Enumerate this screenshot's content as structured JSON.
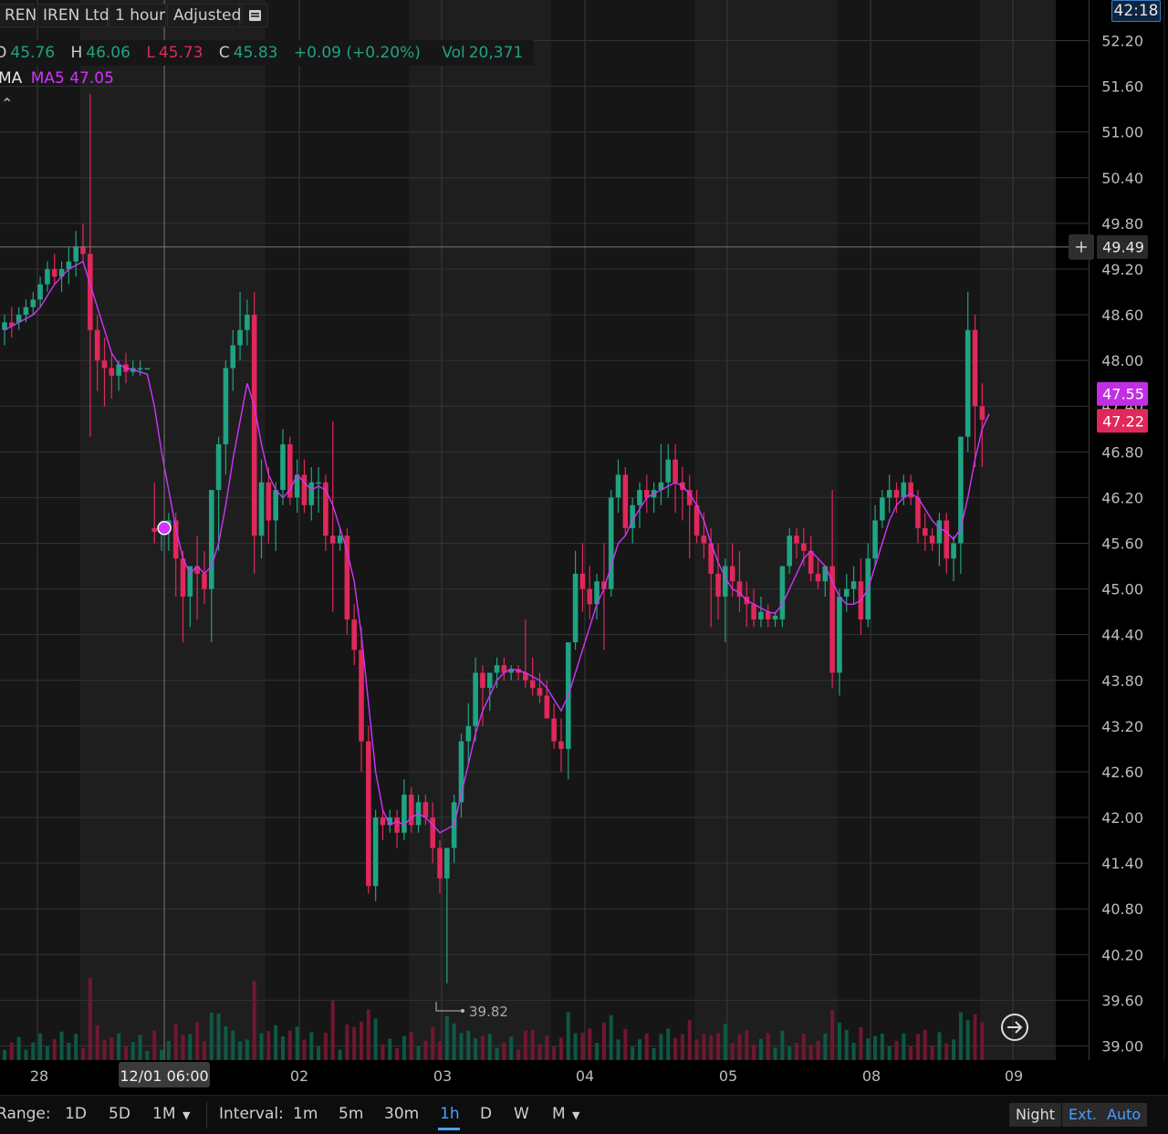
{
  "header": {
    "symbol": "REN",
    "company": "IREN Ltd",
    "interval": "1 hour",
    "adjustment": "Adjusted",
    "menu_icon": "list-icon"
  },
  "ohlc": {
    "open_label": "O",
    "open": "45.76",
    "high_label": "H",
    "high": "46.06",
    "low_label": "L",
    "low": "45.73",
    "close_label": "C",
    "close": "45.83",
    "change": "+0.09 (+0.20%)",
    "vol_label": "Vol",
    "vol": "20,371"
  },
  "indicator": {
    "name": "MA",
    "value_text": "MA5 47.05"
  },
  "clock": "42:18",
  "colors": {
    "up": "#1fa383",
    "down": "#e0285a",
    "ma": "#d233ff",
    "accent": "#4a9eff"
  },
  "chart_data": {
    "type": "candlestick",
    "y_ticks": [
      "52.20",
      "51.60",
      "51.00",
      "50.40",
      "49.80",
      "49.20",
      "48.60",
      "48.00",
      "47.40",
      "46.80",
      "46.20",
      "45.60",
      "45.00",
      "44.40",
      "43.80",
      "43.20",
      "42.60",
      "42.00",
      "41.40",
      "40.80",
      "40.20",
      "39.60",
      "39.00"
    ],
    "ylim": [
      38.9,
      52.4
    ],
    "x_ticks": [
      {
        "label": "28",
        "i": 3
      },
      {
        "label": "02",
        "i": 46
      },
      {
        "label": "03",
        "i": 66
      },
      {
        "label": "04",
        "i": 86
      },
      {
        "label": "05",
        "i": 106
      },
      {
        "label": "08",
        "i": 126
      },
      {
        "label": "09",
        "i": 146
      }
    ],
    "crosshair": {
      "date_label": "12/01 06:00",
      "price_label": "49.49",
      "price": 49.49,
      "i": 22
    },
    "last_close": "47.22",
    "ma_last": "47.55",
    "low_marker": "39.82",
    "candles": [
      [
        48.4,
        48.6,
        48.2,
        48.5
      ],
      [
        48.5,
        48.7,
        48.3,
        48.45
      ],
      [
        48.5,
        48.7,
        48.4,
        48.6
      ],
      [
        48.6,
        48.8,
        48.5,
        48.7
      ],
      [
        48.7,
        48.9,
        48.6,
        48.8
      ],
      [
        48.8,
        49.1,
        48.7,
        49.0
      ],
      [
        49.0,
        49.3,
        48.9,
        49.2
      ],
      [
        49.2,
        49.4,
        49.0,
        49.1
      ],
      [
        49.1,
        49.3,
        48.9,
        49.2
      ],
      [
        49.2,
        49.5,
        49.0,
        49.3
      ],
      [
        49.3,
        49.7,
        49.1,
        49.5
      ],
      [
        49.5,
        49.8,
        49.3,
        49.4
      ],
      [
        49.4,
        51.5,
        47.0,
        48.4
      ],
      [
        48.4,
        48.6,
        47.6,
        48.0
      ],
      [
        48.0,
        48.3,
        47.4,
        47.9
      ],
      [
        47.9,
        48.1,
        47.5,
        47.8
      ],
      [
        47.8,
        48.0,
        47.6,
        47.95
      ],
      [
        47.95,
        48.1,
        47.7,
        47.85
      ],
      [
        47.85,
        48.0,
        47.8,
        47.9
      ],
      [
        47.9,
        48.0,
        47.8,
        47.9
      ],
      [
        47.9,
        47.9,
        47.9,
        47.9
      ],
      [
        45.8,
        46.4,
        45.6,
        45.75
      ],
      [
        45.75,
        45.9,
        45.5,
        45.8
      ],
      [
        45.8,
        46.0,
        45.5,
        45.9
      ],
      [
        45.9,
        46.0,
        44.9,
        45.4
      ],
      [
        45.4,
        45.5,
        44.3,
        44.9
      ],
      [
        44.9,
        45.3,
        44.5,
        45.3
      ],
      [
        45.3,
        45.7,
        44.6,
        45.2
      ],
      [
        45.2,
        45.5,
        44.8,
        45.0
      ],
      [
        45.0,
        46.3,
        44.3,
        46.3
      ],
      [
        46.3,
        47.0,
        45.5,
        46.9
      ],
      [
        46.9,
        48.0,
        46.5,
        47.9
      ],
      [
        47.9,
        48.4,
        47.6,
        48.2
      ],
      [
        48.2,
        48.9,
        48.0,
        48.4
      ],
      [
        48.4,
        48.8,
        48.2,
        48.6
      ],
      [
        48.6,
        48.9,
        45.2,
        45.7
      ],
      [
        45.7,
        46.7,
        45.4,
        46.4
      ],
      [
        46.4,
        46.6,
        45.6,
        45.9
      ],
      [
        45.9,
        46.4,
        45.5,
        46.3
      ],
      [
        46.3,
        47.1,
        46.1,
        46.9
      ],
      [
        46.9,
        47.0,
        46.1,
        46.2
      ],
      [
        46.2,
        46.7,
        46.0,
        46.5
      ],
      [
        46.5,
        46.7,
        46.0,
        46.1
      ],
      [
        46.1,
        46.6,
        45.9,
        46.4
      ],
      [
        46.4,
        46.6,
        46.0,
        46.4
      ],
      [
        46.4,
        46.5,
        45.5,
        45.7
      ],
      [
        45.7,
        47.2,
        44.7,
        45.6
      ],
      [
        45.6,
        45.8,
        45.5,
        45.7
      ],
      [
        45.7,
        45.8,
        44.4,
        44.6
      ],
      [
        44.6,
        44.8,
        44.0,
        44.2
      ],
      [
        44.2,
        44.5,
        42.6,
        43.0
      ],
      [
        43.0,
        43.2,
        41.0,
        41.1
      ],
      [
        41.1,
        42.1,
        40.9,
        42.0
      ],
      [
        42.0,
        42.1,
        41.7,
        41.9
      ],
      [
        41.9,
        42.1,
        41.8,
        42.0
      ],
      [
        42.0,
        42.1,
        41.6,
        41.8
      ],
      [
        41.8,
        42.5,
        41.7,
        42.3
      ],
      [
        42.3,
        42.4,
        41.8,
        41.9
      ],
      [
        41.9,
        42.3,
        41.8,
        42.2
      ],
      [
        42.2,
        42.3,
        41.9,
        42.0
      ],
      [
        42.0,
        42.2,
        41.4,
        41.6
      ],
      [
        41.6,
        41.7,
        41.0,
        41.2
      ],
      [
        41.2,
        41.6,
        39.82,
        41.6
      ],
      [
        41.6,
        42.3,
        41.4,
        42.2
      ],
      [
        42.2,
        43.1,
        42.0,
        43.0
      ],
      [
        43.0,
        43.5,
        42.7,
        43.2
      ],
      [
        43.2,
        44.1,
        43.0,
        43.9
      ],
      [
        43.9,
        44.0,
        43.2,
        43.7
      ],
      [
        43.7,
        43.9,
        43.4,
        43.9
      ],
      [
        43.9,
        44.1,
        43.7,
        44.0
      ],
      [
        44.0,
        44.1,
        43.8,
        43.9
      ],
      [
        43.9,
        44.0,
        43.8,
        43.95
      ],
      [
        43.95,
        44.0,
        43.8,
        43.9
      ],
      [
        43.9,
        44.6,
        43.7,
        43.8
      ],
      [
        43.8,
        44.1,
        43.6,
        43.7
      ],
      [
        43.7,
        43.9,
        43.5,
        43.6
      ],
      [
        43.6,
        43.8,
        43.3,
        43.3
      ],
      [
        43.3,
        43.5,
        42.9,
        43.0
      ],
      [
        43.0,
        43.3,
        42.6,
        42.9
      ],
      [
        42.9,
        44.3,
        42.5,
        44.3
      ],
      [
        44.3,
        45.5,
        44.2,
        45.2
      ],
      [
        45.2,
        45.6,
        44.7,
        45.0
      ],
      [
        45.0,
        45.3,
        44.6,
        44.8
      ],
      [
        44.8,
        45.2,
        44.6,
        45.1
      ],
      [
        45.1,
        45.6,
        44.2,
        45.0
      ],
      [
        45.0,
        46.3,
        44.9,
        46.2
      ],
      [
        46.2,
        46.7,
        46.0,
        46.5
      ],
      [
        46.5,
        46.6,
        45.7,
        45.8
      ],
      [
        45.8,
        46.2,
        45.6,
        46.1
      ],
      [
        46.1,
        46.4,
        45.8,
        46.3
      ],
      [
        46.3,
        46.5,
        46.0,
        46.2
      ],
      [
        46.2,
        46.4,
        46.0,
        46.3
      ],
      [
        46.3,
        46.9,
        46.1,
        46.4
      ],
      [
        46.4,
        46.9,
        46.2,
        46.7
      ],
      [
        46.7,
        46.9,
        46.0,
        46.4
      ],
      [
        46.4,
        46.6,
        45.9,
        46.3
      ],
      [
        46.3,
        46.5,
        45.4,
        46.1
      ],
      [
        46.1,
        46.3,
        45.6,
        45.7
      ],
      [
        45.7,
        46.0,
        45.4,
        45.6
      ],
      [
        45.6,
        45.8,
        44.5,
        45.2
      ],
      [
        45.2,
        45.6,
        44.6,
        44.9
      ],
      [
        44.9,
        45.4,
        44.3,
        45.3
      ],
      [
        45.3,
        45.6,
        44.9,
        45.1
      ],
      [
        45.1,
        45.5,
        44.7,
        44.9
      ],
      [
        44.9,
        45.1,
        44.5,
        44.8
      ],
      [
        44.8,
        45.0,
        44.5,
        44.6
      ],
      [
        44.6,
        44.9,
        44.5,
        44.7
      ],
      [
        44.7,
        44.8,
        44.5,
        44.6
      ],
      [
        44.6,
        44.7,
        44.5,
        44.65
      ],
      [
        44.6,
        45.3,
        44.5,
        45.3
      ],
      [
        45.3,
        45.8,
        45.2,
        45.7
      ],
      [
        45.7,
        45.8,
        45.4,
        45.6
      ],
      [
        45.6,
        45.8,
        45.3,
        45.5
      ],
      [
        45.5,
        45.7,
        45.1,
        45.2
      ],
      [
        45.2,
        45.4,
        45.0,
        45.1
      ],
      [
        45.1,
        45.3,
        44.9,
        45.3
      ],
      [
        45.3,
        46.3,
        43.7,
        43.9
      ],
      [
        43.9,
        45.0,
        43.6,
        44.9
      ],
      [
        44.9,
        45.2,
        44.7,
        45.0
      ],
      [
        45.0,
        45.3,
        44.8,
        45.1
      ],
      [
        45.1,
        45.4,
        44.4,
        44.6
      ],
      [
        44.6,
        45.6,
        44.5,
        45.4
      ],
      [
        45.4,
        46.1,
        45.3,
        45.9
      ],
      [
        45.9,
        46.3,
        45.8,
        46.2
      ],
      [
        46.2,
        46.5,
        46.0,
        46.3
      ],
      [
        46.3,
        46.4,
        46.0,
        46.2
      ],
      [
        46.2,
        46.5,
        46.1,
        46.4
      ],
      [
        46.4,
        46.5,
        46.1,
        46.2
      ],
      [
        46.2,
        46.3,
        45.6,
        45.8
      ],
      [
        45.8,
        46.0,
        45.5,
        45.7
      ],
      [
        45.7,
        45.8,
        45.5,
        45.6
      ],
      [
        45.6,
        46.0,
        45.3,
        45.9
      ],
      [
        45.9,
        46.0,
        45.2,
        45.4
      ],
      [
        45.4,
        45.7,
        45.1,
        45.6
      ],
      [
        45.6,
        47.0,
        45.2,
        47.0
      ],
      [
        47.0,
        48.9,
        46.8,
        48.4
      ],
      [
        48.4,
        48.6,
        46.6,
        47.4
      ],
      [
        47.4,
        47.7,
        46.6,
        47.22
      ]
    ],
    "ma5": [
      48.4,
      48.45,
      48.5,
      48.55,
      48.6,
      48.7,
      48.85,
      49.0,
      49.1,
      49.2,
      49.25,
      49.3,
      49.0,
      48.7,
      48.4,
      48.1,
      47.95,
      47.9,
      47.88,
      47.85,
      47.82,
      47.4,
      46.8,
      46.3,
      45.8,
      45.4,
      45.2,
      45.3,
      45.2,
      45.3,
      45.6,
      46.1,
      46.7,
      47.2,
      47.7,
      47.4,
      46.9,
      46.5,
      46.3,
      46.2,
      46.3,
      46.5,
      46.4,
      46.3,
      46.35,
      46.3,
      46.1,
      45.8,
      45.5,
      45.1,
      44.4,
      43.5,
      42.6,
      42.1,
      41.9,
      41.95,
      41.9,
      42.0,
      42.05,
      42.0,
      41.9,
      41.8,
      41.85,
      41.9,
      42.3,
      42.7,
      43.1,
      43.4,
      43.6,
      43.8,
      43.9,
      43.95,
      43.93,
      43.9,
      43.85,
      43.8,
      43.7,
      43.55,
      43.4,
      43.6,
      43.9,
      44.2,
      44.5,
      44.8,
      45.0,
      45.3,
      45.6,
      45.7,
      45.9,
      46.05,
      46.2,
      46.25,
      46.3,
      46.35,
      46.4,
      46.35,
      46.25,
      46.1,
      45.9,
      45.6,
      45.35,
      45.15,
      45.0,
      44.95,
      44.85,
      44.8,
      44.75,
      44.7,
      44.68,
      44.8,
      45.0,
      45.2,
      45.4,
      45.5,
      45.4,
      45.3,
      45.1,
      44.9,
      44.8,
      44.8,
      44.85,
      45.0,
      45.3,
      45.6,
      45.9,
      46.1,
      46.2,
      46.25,
      46.2,
      46.05,
      45.9,
      45.8,
      45.75,
      45.65,
      45.8,
      46.2,
      46.7,
      47.1,
      47.3
    ]
  },
  "bottom_bar": {
    "range_label": "Range:",
    "ranges": [
      "1D",
      "5D",
      "1M"
    ],
    "interval_label": "Interval:",
    "intervals": [
      "1m",
      "5m",
      "30m",
      "1h",
      "D",
      "W",
      "M"
    ],
    "active_interval": "1h",
    "toggles": [
      "Night",
      "Ext.",
      "Auto"
    ]
  }
}
